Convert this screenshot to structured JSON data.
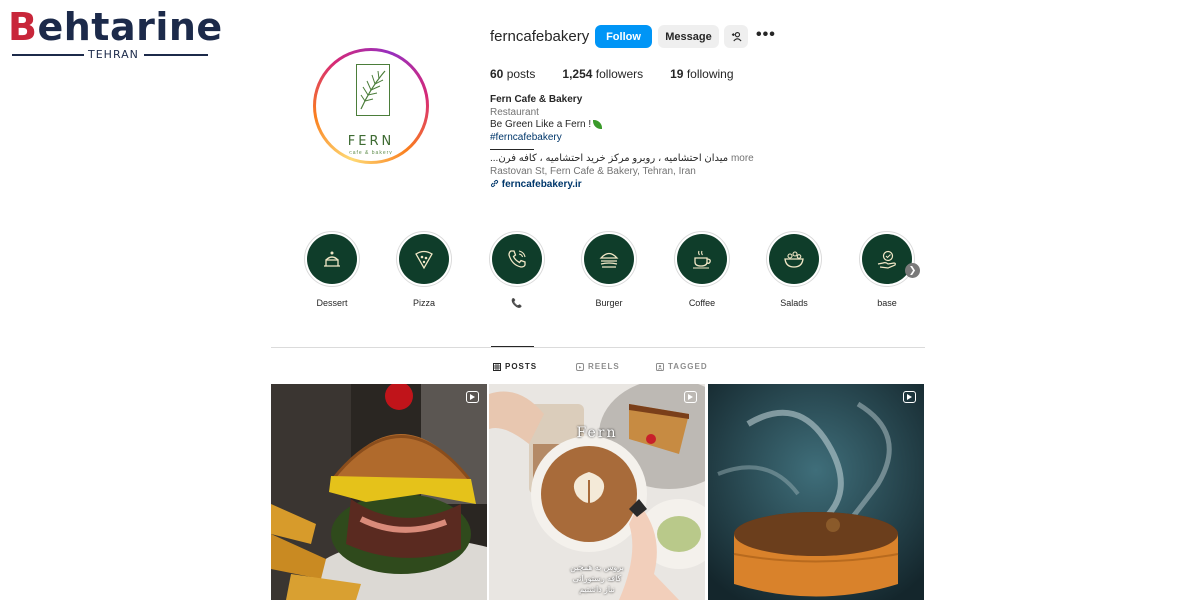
{
  "watermark": {
    "wordmark_b": "B",
    "wordmark_rest": "ehtarine",
    "subtitle": "TEHRAN"
  },
  "profile": {
    "avatar_name": "FERN",
    "avatar_sub": "cafe & bakery",
    "username": "ferncafebakery",
    "follow_label": "Follow",
    "message_label": "Message",
    "add_user_icon": "add-person-icon",
    "more_label": "•••",
    "stats": {
      "posts_count": "60",
      "posts_label": "posts",
      "followers_count": "1,254",
      "followers_label": "followers",
      "following_count": "19",
      "following_label": "following"
    },
    "bio": {
      "name": "Fern Cafe & Bakery",
      "category": "Restaurant",
      "tagline": "Be Green Like a Fern !",
      "hashtag": "#ferncafebakery",
      "farsi": "میدان احتشامیه ، روبرو مرکز خرید احتشامیه ، کافه فرن...",
      "more": "more",
      "address": "Rastovan St, Fern Cafe & Bakery, Tehran, Iran",
      "link": "ferncafebakery.ir"
    }
  },
  "highlights": [
    {
      "label": "Dessert",
      "icon": "cake-icon"
    },
    {
      "label": "Pizza",
      "icon": "pizza-icon"
    },
    {
      "label": "📞",
      "icon": "phone-icon"
    },
    {
      "label": "Burger",
      "icon": "burger-icon"
    },
    {
      "label": "Coffee",
      "icon": "coffee-cup-icon"
    },
    {
      "label": "Salads",
      "icon": "salad-bowl-icon"
    },
    {
      "label": "base",
      "icon": "hand-badge-icon"
    }
  ],
  "tabs": [
    {
      "label": "POSTS",
      "icon": "grid-icon",
      "active": true
    },
    {
      "label": "REELS",
      "icon": "reels-icon",
      "active": false
    },
    {
      "label": "TAGGED",
      "icon": "tagged-icon",
      "active": false
    }
  ],
  "posts": [
    {
      "alt": "burger-with-fries",
      "reel": true
    },
    {
      "alt": "latte-art-cheesecake",
      "reel": true,
      "overlay_title": "Fern",
      "caption_line1": "بروس به همچین",
      "caption_line2": "کافه رستورانی",
      "caption_line3": "نیاز داشتیم"
    },
    {
      "alt": "smoked-tart",
      "reel": true
    }
  ],
  "colors": {
    "follow_blue": "#0095f6",
    "highlight_bg": "#0f3d2a",
    "brand_green": "#3e6b33"
  }
}
